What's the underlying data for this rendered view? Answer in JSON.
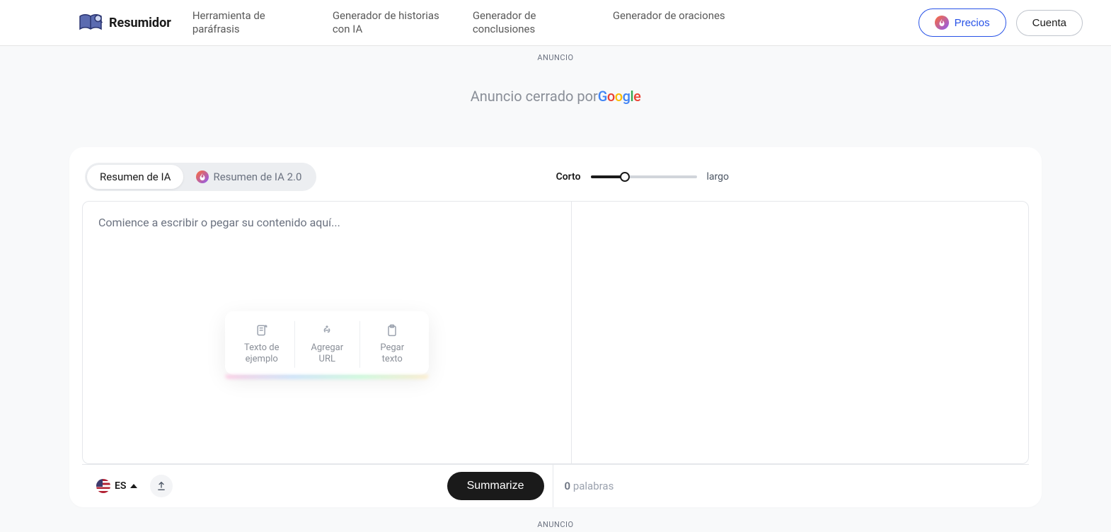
{
  "brand": "Resumidor",
  "nav": {
    "paraphrase": "Herramienta de paráfrasis",
    "story": "Generador de historias con IA",
    "conclusion": "Generador de conclusiones",
    "sentence": "Generador de oraciones"
  },
  "actions": {
    "prices": "Precios",
    "account": "Cuenta"
  },
  "ad": {
    "label": "ANUNCIO",
    "closed_prefix": "Anuncio cerrado por"
  },
  "tabs": {
    "v1": "Resumen de IA",
    "v2": "Resumen de IA 2.0"
  },
  "slider": {
    "short": "Corto",
    "long": "largo"
  },
  "editor": {
    "placeholder": "Comience a escribir o pegar su contenido aquí..."
  },
  "helpers": {
    "sample": "Texto de ejemplo",
    "url": "Agregar URL",
    "paste": "Pegar texto"
  },
  "lang": {
    "code": "ES"
  },
  "buttons": {
    "summarize": "Summarize"
  },
  "output": {
    "count": "0",
    "words_label": "palabras"
  }
}
